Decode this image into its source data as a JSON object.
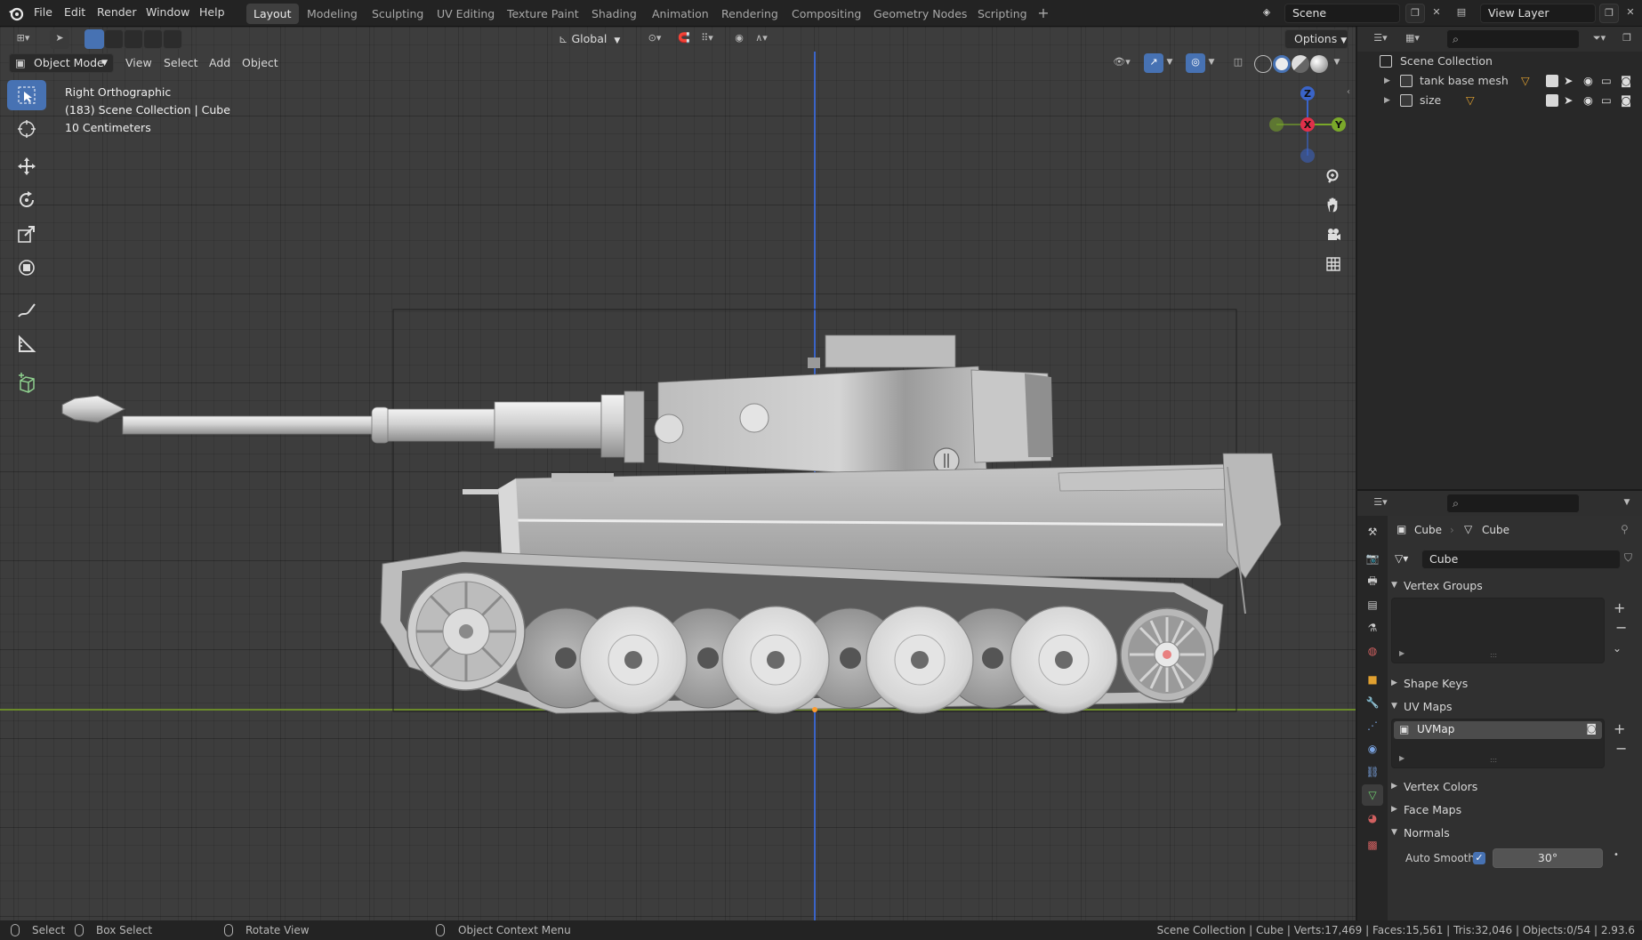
{
  "menus": [
    "File",
    "Edit",
    "Render",
    "Window",
    "Help"
  ],
  "workspaces": [
    "Layout",
    "Modeling",
    "Sculpting",
    "UV Editing",
    "Texture Paint",
    "Shading",
    "Animation",
    "Rendering",
    "Compositing",
    "Geometry Nodes",
    "Scripting"
  ],
  "active_workspace": "Layout",
  "scene": {
    "name": "Scene",
    "view_layer": "View Layer"
  },
  "viewport_header": {
    "transform_orientation": "Global",
    "options_label": "Options",
    "mode": "Object Mode",
    "menus": [
      "View",
      "Select",
      "Add",
      "Object"
    ]
  },
  "viewport_overlay": {
    "view_name": "Right Orthographic",
    "context": "(183) Scene Collection | Cube",
    "scale": "10 Centimeters"
  },
  "gizmo": {
    "x": "X",
    "y": "Y",
    "z": "Z"
  },
  "outliner": {
    "root": "Scene Collection",
    "items": [
      {
        "name": "tank base mesh"
      },
      {
        "name": "size"
      }
    ]
  },
  "properties": {
    "breadcrumb_object": "Cube",
    "breadcrumb_data": "Cube",
    "mesh_name": "Cube",
    "panels": {
      "vertex_groups": "Vertex Groups",
      "shape_keys": "Shape Keys",
      "uv_maps": "UV Maps",
      "vertex_colors": "Vertex Colors",
      "face_maps": "Face Maps",
      "normals": "Normals"
    },
    "uv_map_name": "UVMap",
    "auto_smooth_label": "Auto Smooth",
    "auto_smooth_checked": true,
    "auto_smooth_angle": "30°"
  },
  "statusbar": {
    "select": "Select",
    "box_select": "Box Select",
    "rotate_view": "Rotate View",
    "context_menu": "Object Context Menu",
    "stats": "Scene Collection | Cube | Verts:17,469 | Faces:15,561 | Tris:32,046 | Objects:0/54 | 2.93.6"
  },
  "colors": {
    "accent": "#4772b3",
    "axis_x": "#e0304a",
    "axis_y": "#7aa82a",
    "axis_z": "#3a64c8",
    "viewport_bg": "#3d3d3d"
  }
}
